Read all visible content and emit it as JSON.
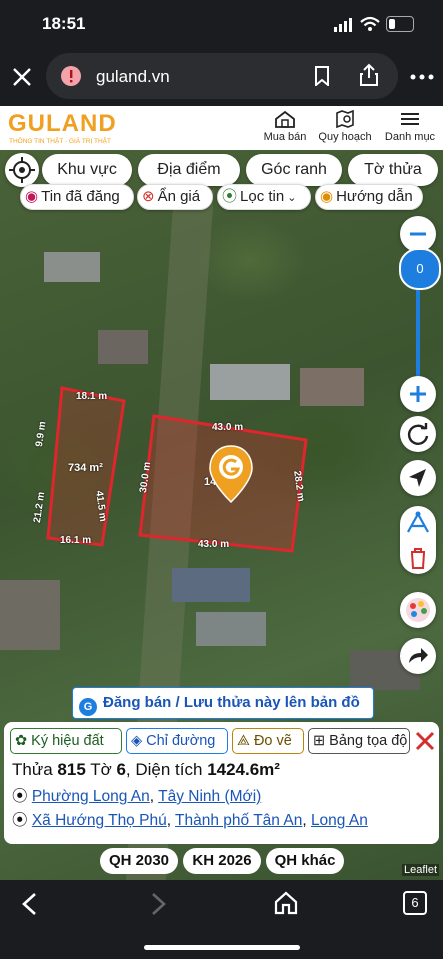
{
  "status": {
    "time": "18:51"
  },
  "browser": {
    "url": "guland.vn"
  },
  "header": {
    "logo": "GULAND",
    "tagline": "THÔNG TIN THẬT · GIÁ TRỊ THẬT",
    "menu": [
      {
        "label": "Mua bán",
        "icon": "house-icon"
      },
      {
        "label": "Quy hoạch",
        "icon": "map-search-icon"
      },
      {
        "label": "Danh mục",
        "icon": "menu-icon"
      }
    ]
  },
  "filters": {
    "row1": [
      "Khu vực",
      "Địa điểm",
      "Góc ranh",
      "Tờ thửa"
    ],
    "row2": [
      "Tin đã đăng",
      "Ẩn giá",
      "Lọc tin",
      "Hướng dẫn"
    ]
  },
  "zoom": {
    "level": "0"
  },
  "plots": {
    "left": {
      "top": "18.1 m",
      "left_upper": "9.9 m",
      "left_lower": "21.2 m",
      "right": "41.5 m",
      "bottom": "16.1 m",
      "area": "734 m²"
    },
    "right": {
      "top": "43.0 m",
      "left": "30.0 m",
      "right": "28.2 m",
      "bottom": "43.0 m",
      "area_partial": "14"
    }
  },
  "post_banner": "Đăng bán / Lưu thửa này lên bản đồ",
  "panel": {
    "tags": [
      "Ký hiệu đất",
      "Chỉ đường",
      "Đo vẽ",
      "Bảng tọa độ"
    ],
    "title_prefix": "Thửa ",
    "parcel_no": "815",
    "sheet_prefix": " Tờ ",
    "sheet_no": "6",
    "area_prefix": ", Diện tích ",
    "area": "1424.6m²",
    "address_new": {
      "ward": "Phường Long An",
      "sep": ", ",
      "province": "Tây Ninh (Mới)"
    },
    "address_old": {
      "commune": "Xã Hướng Thọ Phú",
      "city": "Thành phố Tân An",
      "province": "Long An"
    }
  },
  "plan_buttons": [
    "QH 2030",
    "KH 2026",
    "QH khác"
  ],
  "attribution": "Leaflet",
  "tabs_count": "6",
  "colors": {
    "brand": "#f0a020",
    "link": "#1a55b8",
    "plot": "#e0262d",
    "accent_blue": "#1e7ee0"
  }
}
